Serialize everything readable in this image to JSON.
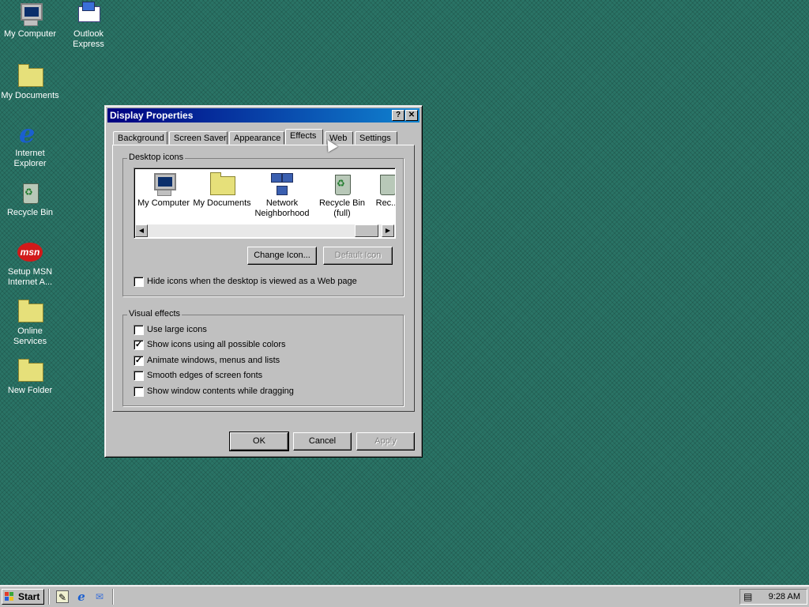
{
  "desktop": {
    "icons": [
      {
        "label": "My Computer",
        "icon": "computer-icon"
      },
      {
        "label": "Outlook Express",
        "icon": "mail-icon"
      },
      {
        "label": "My Documents",
        "icon": "folder-icon"
      },
      {
        "label": "Internet Explorer",
        "icon": "ie-icon"
      },
      {
        "label": "Recycle Bin",
        "icon": "recycle-bin-icon"
      },
      {
        "label": "Setup MSN Internet A...",
        "icon": "msn-icon"
      },
      {
        "label": "Online Services",
        "icon": "folder-icon"
      },
      {
        "label": "New Folder",
        "icon": "folder-icon"
      }
    ]
  },
  "dialog": {
    "title": "Display Properties",
    "help_btn": "?",
    "close_btn": "✕",
    "tabs": [
      "Background",
      "Screen Saver",
      "Appearance",
      "Effects",
      "Web",
      "Settings"
    ],
    "active_tab": "Effects",
    "desktop_icons": {
      "label": "Desktop icons",
      "items": [
        "My Computer",
        "My Documents",
        "Network Neighborhood",
        "Recycle Bin (full)",
        "Rec..."
      ],
      "change_icon": "Change Icon...",
      "default_icon": "Default Icon",
      "hide_icons": {
        "label": "Hide icons when the desktop is viewed as a Web page",
        "checked": false
      }
    },
    "visual_effects": {
      "label": "Visual effects",
      "options": [
        {
          "label": "Use large icons",
          "checked": false
        },
        {
          "label": "Show icons using all possible colors",
          "checked": true
        },
        {
          "label": "Animate windows, menus and lists",
          "checked": true
        },
        {
          "label": "Smooth edges of screen fonts",
          "checked": false
        },
        {
          "label": "Show window contents while dragging",
          "checked": false
        }
      ]
    },
    "ok": "OK",
    "cancel": "Cancel",
    "apply": "Apply"
  },
  "taskbar": {
    "start": "Start",
    "clock": "9:28 AM"
  }
}
